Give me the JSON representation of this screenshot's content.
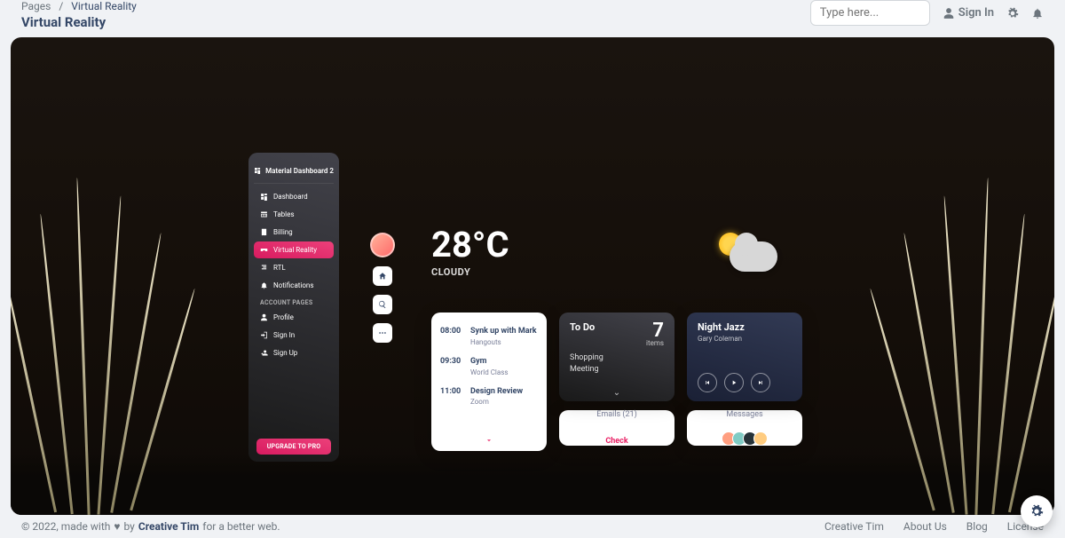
{
  "breadcrumb": {
    "root": "Pages",
    "current": "Virtual Reality"
  },
  "page_title": "Virtual Reality",
  "search": {
    "placeholder": "Type here..."
  },
  "header_links": {
    "sign_in": "Sign In"
  },
  "sidenav": {
    "brand": "Material Dashboard 2",
    "items": [
      {
        "label": "Dashboard",
        "icon": "dashboard"
      },
      {
        "label": "Tables",
        "icon": "table"
      },
      {
        "label": "Billing",
        "icon": "receipt"
      },
      {
        "label": "Virtual Reality",
        "icon": "vr",
        "active": true
      },
      {
        "label": "RTL",
        "icon": "rtl"
      },
      {
        "label": "Notifications",
        "icon": "bell"
      }
    ],
    "section_label": "ACCOUNT PAGES",
    "account_items": [
      {
        "label": "Profile",
        "icon": "person"
      },
      {
        "label": "Sign In",
        "icon": "login"
      },
      {
        "label": "Sign Up",
        "icon": "signup"
      }
    ],
    "upgrade": "UPGRADE TO PRO"
  },
  "weather": {
    "temp": "28°C",
    "condition": "CLOUDY"
  },
  "schedule": [
    {
      "time": "08:00",
      "title": "Synk up with Mark",
      "sub": "Hangouts"
    },
    {
      "time": "09:30",
      "title": "Gym",
      "sub": "World Class"
    },
    {
      "time": "11:00",
      "title": "Design Review",
      "sub": "Zoom"
    }
  ],
  "todo": {
    "title": "To Do",
    "count": "7",
    "items_label": "items",
    "list": [
      "Shopping",
      "Meeting"
    ]
  },
  "emails": {
    "label": "Emails (21)",
    "action": "Check"
  },
  "music": {
    "title": "Night Jazz",
    "artist": "Gary Coleman"
  },
  "messages": {
    "label": "Messages"
  },
  "footer": {
    "prefix": "© 2022, made with",
    "by": "by",
    "brand": "Creative Tim",
    "suffix": "for a better web.",
    "links": [
      "Creative Tim",
      "About Us",
      "Blog",
      "License"
    ]
  }
}
